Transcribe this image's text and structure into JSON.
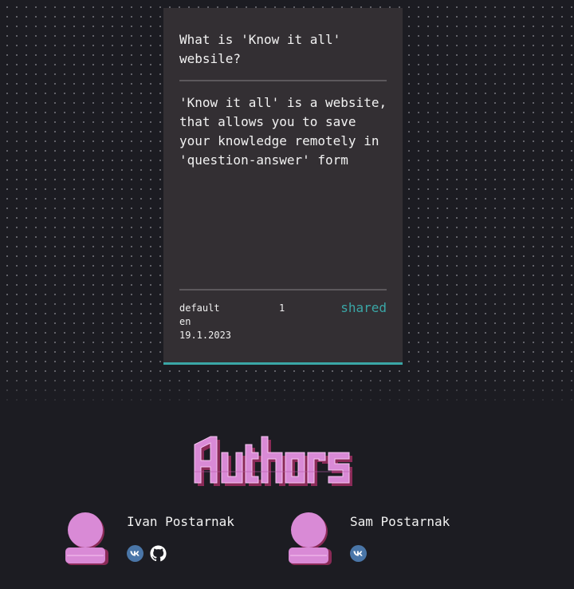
{
  "card": {
    "question": "What is 'Know it all'\nwebsile?",
    "answer": "'Know it all' is a website,\nthat allows you to save\nyour knowledge remotely in\n'question-answer' form",
    "category": "default",
    "language": "en",
    "date": "19.1.2023",
    "count": "1",
    "shared_label": "shared",
    "accent_color": "#3aa6a6"
  },
  "authors": {
    "title": "Authors",
    "title_color": "#d98ad6",
    "people": [
      {
        "name": "Ivan Postarnak",
        "links": [
          "vk-icon",
          "github-icon"
        ]
      },
      {
        "name": "Sam Postarnak",
        "links": [
          "vk-icon"
        ]
      }
    ]
  }
}
